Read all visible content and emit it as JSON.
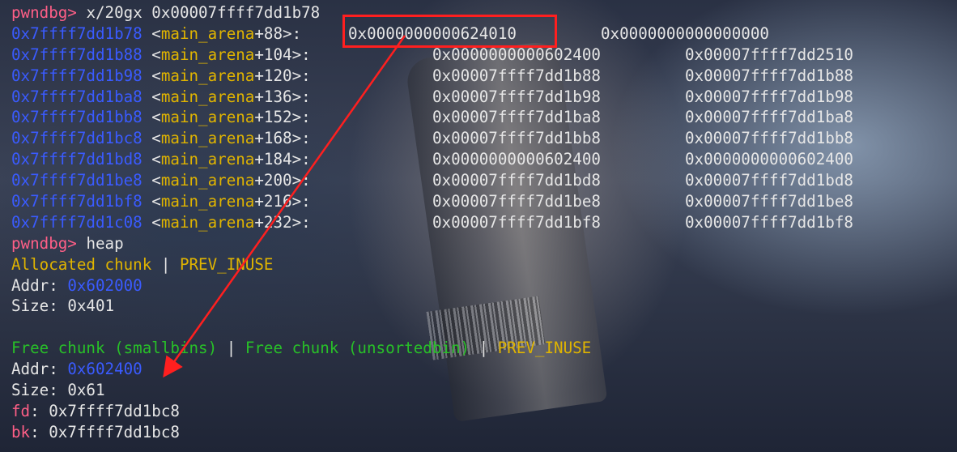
{
  "prompt": "pwndbg>",
  "commands": {
    "examine": "x/20gx 0x00007ffff7dd1b78",
    "heap": "heap"
  },
  "memory_rows": [
    {
      "addr": "0x7ffff7dd1b78",
      "sym": "main_arena",
      "off": "+88>:",
      "v1": "0x0000000000624010",
      "v2": "0x0000000000000000"
    },
    {
      "addr": "0x7ffff7dd1b88",
      "sym": "main_arena",
      "off": "+104>:",
      "v1": "0x0000000000602400",
      "v2": "0x00007ffff7dd2510"
    },
    {
      "addr": "0x7ffff7dd1b98",
      "sym": "main_arena",
      "off": "+120>:",
      "v1": "0x00007ffff7dd1b88",
      "v2": "0x00007ffff7dd1b88"
    },
    {
      "addr": "0x7ffff7dd1ba8",
      "sym": "main_arena",
      "off": "+136>:",
      "v1": "0x00007ffff7dd1b98",
      "v2": "0x00007ffff7dd1b98"
    },
    {
      "addr": "0x7ffff7dd1bb8",
      "sym": "main_arena",
      "off": "+152>:",
      "v1": "0x00007ffff7dd1ba8",
      "v2": "0x00007ffff7dd1ba8"
    },
    {
      "addr": "0x7ffff7dd1bc8",
      "sym": "main_arena",
      "off": "+168>:",
      "v1": "0x00007ffff7dd1bb8",
      "v2": "0x00007ffff7dd1bb8"
    },
    {
      "addr": "0x7ffff7dd1bd8",
      "sym": "main_arena",
      "off": "+184>:",
      "v1": "0x0000000000602400",
      "v2": "0x0000000000602400"
    },
    {
      "addr": "0x7ffff7dd1be8",
      "sym": "main_arena",
      "off": "+200>:",
      "v1": "0x00007ffff7dd1bd8",
      "v2": "0x00007ffff7dd1bd8"
    },
    {
      "addr": "0x7ffff7dd1bf8",
      "sym": "main_arena",
      "off": "+216>:",
      "v1": "0x00007ffff7dd1be8",
      "v2": "0x00007ffff7dd1be8"
    },
    {
      "addr": "0x7ffff7dd1c08",
      "sym": "main_arena",
      "off": "+232>:",
      "v1": "0x00007ffff7dd1bf8",
      "v2": "0x00007ffff7dd1bf8"
    }
  ],
  "chunk1": {
    "status": "Allocated chunk",
    "sep": " | ",
    "flag": "PREV_INUSE",
    "addr_label": "Addr: ",
    "addr": "0x602000",
    "size_label": "Size: ",
    "size": "0x401"
  },
  "chunk2": {
    "status1": "Free chunk (smallbins)",
    "sep1": " | ",
    "status2": "Free chunk (unsortedbin)",
    "sep2": " | ",
    "flag": "PREV_INUSE",
    "addr_label": "Addr: ",
    "addr": "0x602400",
    "size_label": "Size: ",
    "size": "0x61",
    "fd_label": "fd",
    "fd": ": 0x7ffff7dd1bc8",
    "bk_label": "bk",
    "bk": ": 0x7ffff7dd1bc8"
  },
  "colors": {
    "prompt": "#ff5f87",
    "address": "#3a5bff",
    "symbol": "#e0b400",
    "free": "#28c028",
    "annotation": "#ff1f1f"
  }
}
